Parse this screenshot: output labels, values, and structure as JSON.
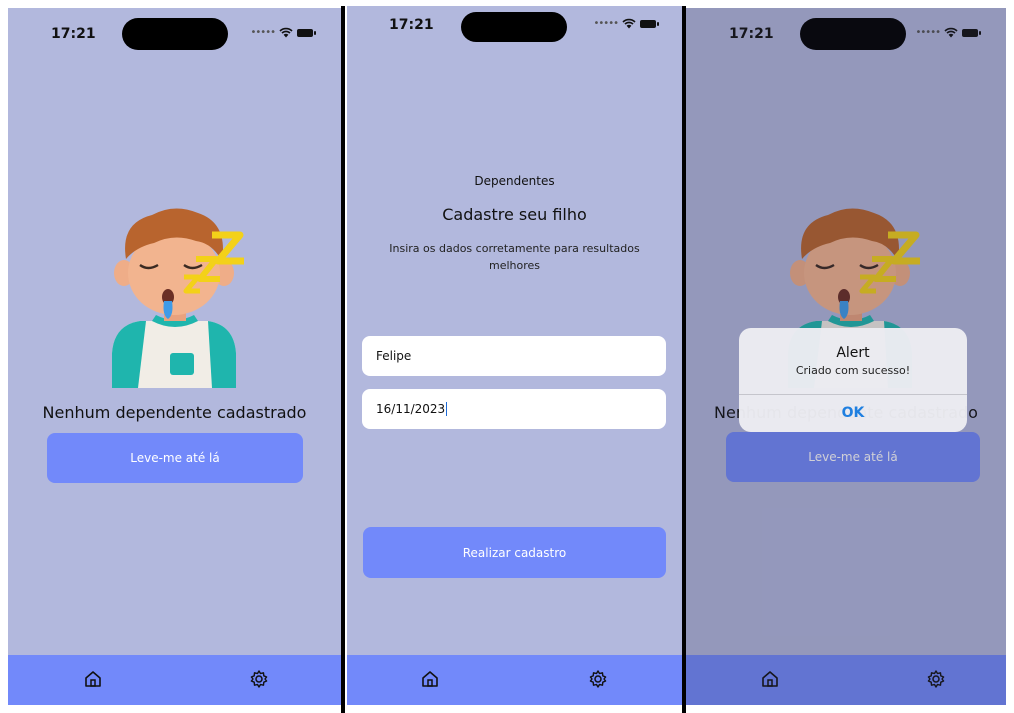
{
  "status": {
    "time": "17:21"
  },
  "screen1": {
    "empty_title": "Nenhum dependente cadastrado",
    "button_label": "Leve-me até lá"
  },
  "screen2": {
    "small_title": "Dependentes",
    "title": "Cadastre seu filho",
    "description": "Insira os dados corretamente para resultados melhores",
    "name_value": "Felipe",
    "date_value": "16/11/2023",
    "submit_label": "Realizar cadastro"
  },
  "screen3": {
    "empty_title": "Nenhum dependente cadastrado",
    "button_label": "Leve-me até lá",
    "alert": {
      "title": "Alert",
      "message": "Criado com sucesso!",
      "ok": "OK"
    }
  },
  "tabbar": {
    "items": [
      {
        "icon": "home-icon"
      },
      {
        "icon": "gear-icon"
      }
    ]
  },
  "colors": {
    "background": "#b2b8dd",
    "primary": "#7289fa",
    "alert_button": "#1f7fe0"
  }
}
